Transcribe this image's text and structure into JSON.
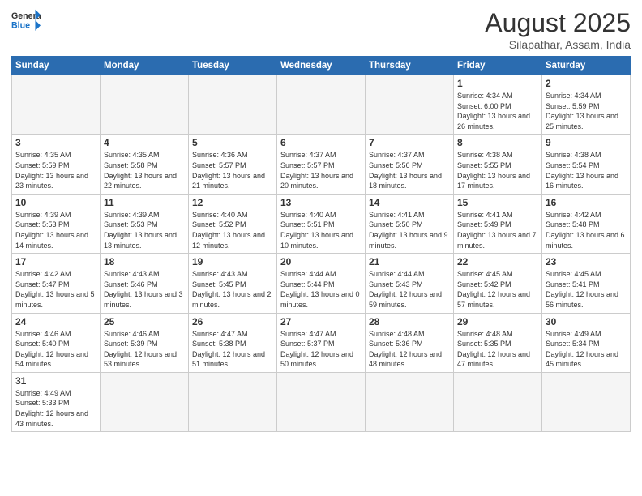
{
  "header": {
    "logo_general": "General",
    "logo_blue": "Blue",
    "month_year": "August 2025",
    "location": "Silapathar, Assam, India"
  },
  "days_of_week": [
    "Sunday",
    "Monday",
    "Tuesday",
    "Wednesday",
    "Thursday",
    "Friday",
    "Saturday"
  ],
  "weeks": [
    [
      {
        "day": "",
        "info": ""
      },
      {
        "day": "",
        "info": ""
      },
      {
        "day": "",
        "info": ""
      },
      {
        "day": "",
        "info": ""
      },
      {
        "day": "",
        "info": ""
      },
      {
        "day": "1",
        "info": "Sunrise: 4:34 AM\nSunset: 6:00 PM\nDaylight: 13 hours and 26 minutes."
      },
      {
        "day": "2",
        "info": "Sunrise: 4:34 AM\nSunset: 5:59 PM\nDaylight: 13 hours and 25 minutes."
      }
    ],
    [
      {
        "day": "3",
        "info": "Sunrise: 4:35 AM\nSunset: 5:59 PM\nDaylight: 13 hours and 23 minutes."
      },
      {
        "day": "4",
        "info": "Sunrise: 4:35 AM\nSunset: 5:58 PM\nDaylight: 13 hours and 22 minutes."
      },
      {
        "day": "5",
        "info": "Sunrise: 4:36 AM\nSunset: 5:57 PM\nDaylight: 13 hours and 21 minutes."
      },
      {
        "day": "6",
        "info": "Sunrise: 4:37 AM\nSunset: 5:57 PM\nDaylight: 13 hours and 20 minutes."
      },
      {
        "day": "7",
        "info": "Sunrise: 4:37 AM\nSunset: 5:56 PM\nDaylight: 13 hours and 18 minutes."
      },
      {
        "day": "8",
        "info": "Sunrise: 4:38 AM\nSunset: 5:55 PM\nDaylight: 13 hours and 17 minutes."
      },
      {
        "day": "9",
        "info": "Sunrise: 4:38 AM\nSunset: 5:54 PM\nDaylight: 13 hours and 16 minutes."
      }
    ],
    [
      {
        "day": "10",
        "info": "Sunrise: 4:39 AM\nSunset: 5:53 PM\nDaylight: 13 hours and 14 minutes."
      },
      {
        "day": "11",
        "info": "Sunrise: 4:39 AM\nSunset: 5:53 PM\nDaylight: 13 hours and 13 minutes."
      },
      {
        "day": "12",
        "info": "Sunrise: 4:40 AM\nSunset: 5:52 PM\nDaylight: 13 hours and 12 minutes."
      },
      {
        "day": "13",
        "info": "Sunrise: 4:40 AM\nSunset: 5:51 PM\nDaylight: 13 hours and 10 minutes."
      },
      {
        "day": "14",
        "info": "Sunrise: 4:41 AM\nSunset: 5:50 PM\nDaylight: 13 hours and 9 minutes."
      },
      {
        "day": "15",
        "info": "Sunrise: 4:41 AM\nSunset: 5:49 PM\nDaylight: 13 hours and 7 minutes."
      },
      {
        "day": "16",
        "info": "Sunrise: 4:42 AM\nSunset: 5:48 PM\nDaylight: 13 hours and 6 minutes."
      }
    ],
    [
      {
        "day": "17",
        "info": "Sunrise: 4:42 AM\nSunset: 5:47 PM\nDaylight: 13 hours and 5 minutes."
      },
      {
        "day": "18",
        "info": "Sunrise: 4:43 AM\nSunset: 5:46 PM\nDaylight: 13 hours and 3 minutes."
      },
      {
        "day": "19",
        "info": "Sunrise: 4:43 AM\nSunset: 5:45 PM\nDaylight: 13 hours and 2 minutes."
      },
      {
        "day": "20",
        "info": "Sunrise: 4:44 AM\nSunset: 5:44 PM\nDaylight: 13 hours and 0 minutes."
      },
      {
        "day": "21",
        "info": "Sunrise: 4:44 AM\nSunset: 5:43 PM\nDaylight: 12 hours and 59 minutes."
      },
      {
        "day": "22",
        "info": "Sunrise: 4:45 AM\nSunset: 5:42 PM\nDaylight: 12 hours and 57 minutes."
      },
      {
        "day": "23",
        "info": "Sunrise: 4:45 AM\nSunset: 5:41 PM\nDaylight: 12 hours and 56 minutes."
      }
    ],
    [
      {
        "day": "24",
        "info": "Sunrise: 4:46 AM\nSunset: 5:40 PM\nDaylight: 12 hours and 54 minutes."
      },
      {
        "day": "25",
        "info": "Sunrise: 4:46 AM\nSunset: 5:39 PM\nDaylight: 12 hours and 53 minutes."
      },
      {
        "day": "26",
        "info": "Sunrise: 4:47 AM\nSunset: 5:38 PM\nDaylight: 12 hours and 51 minutes."
      },
      {
        "day": "27",
        "info": "Sunrise: 4:47 AM\nSunset: 5:37 PM\nDaylight: 12 hours and 50 minutes."
      },
      {
        "day": "28",
        "info": "Sunrise: 4:48 AM\nSunset: 5:36 PM\nDaylight: 12 hours and 48 minutes."
      },
      {
        "day": "29",
        "info": "Sunrise: 4:48 AM\nSunset: 5:35 PM\nDaylight: 12 hours and 47 minutes."
      },
      {
        "day": "30",
        "info": "Sunrise: 4:49 AM\nSunset: 5:34 PM\nDaylight: 12 hours and 45 minutes."
      }
    ],
    [
      {
        "day": "31",
        "info": "Sunrise: 4:49 AM\nSunset: 5:33 PM\nDaylight: 12 hours and 43 minutes."
      },
      {
        "day": "",
        "info": ""
      },
      {
        "day": "",
        "info": ""
      },
      {
        "day": "",
        "info": ""
      },
      {
        "day": "",
        "info": ""
      },
      {
        "day": "",
        "info": ""
      },
      {
        "day": "",
        "info": ""
      }
    ]
  ]
}
